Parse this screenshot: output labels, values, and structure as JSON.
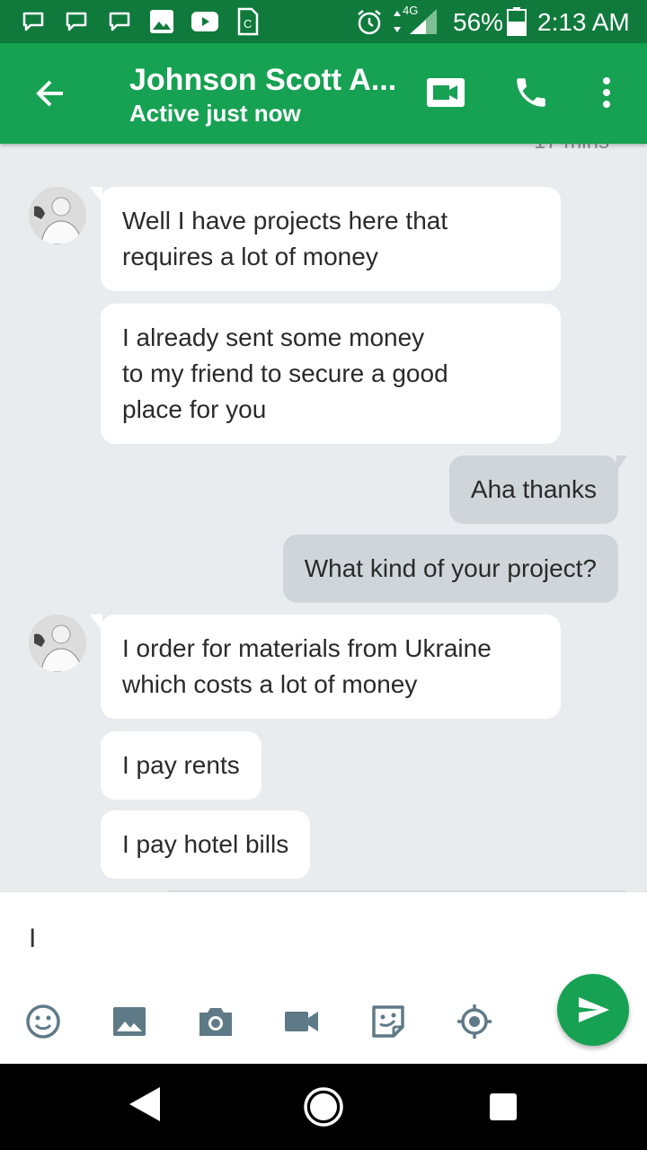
{
  "status_bar": {
    "network": "4G",
    "battery": "56%",
    "time": "2:13 AM"
  },
  "header": {
    "contact_name": "Johnson Scott A...",
    "presence": "Active just now"
  },
  "chat": {
    "time_stub": "17 mins",
    "messages": [
      {
        "text": "Well I have projects here that\nrequires a lot of money"
      },
      {
        "text": "I already sent some money\nto my friend to secure a good\nplace for you"
      },
      {
        "text": "Aha thanks"
      },
      {
        "text": "What kind of your project?"
      },
      {
        "text": "I order for materials from Ukraine\nwhich costs a lot of money"
      },
      {
        "text": "I pay rents"
      },
      {
        "text": "I pay hotel bills"
      }
    ]
  },
  "composer": {
    "value": "I"
  },
  "colors": {
    "status_bar": "#0f7a3c",
    "app_bar": "#17a153",
    "send_button": "#17a153",
    "incoming_bubble": "#ffffff",
    "outgoing_bubble": "#cfd5d9",
    "tool_icon": "#5f7a87"
  },
  "icons": {
    "header": [
      "back-arrow-icon",
      "video-call-icon",
      "phone-icon",
      "more-vert-icon"
    ],
    "composer": [
      "emoji-icon",
      "image-icon",
      "camera-icon",
      "video-icon",
      "sticker-icon",
      "location-icon",
      "send-icon"
    ],
    "nav": [
      "back-triangle-icon",
      "home-circle-icon",
      "recents-square-icon"
    ]
  }
}
